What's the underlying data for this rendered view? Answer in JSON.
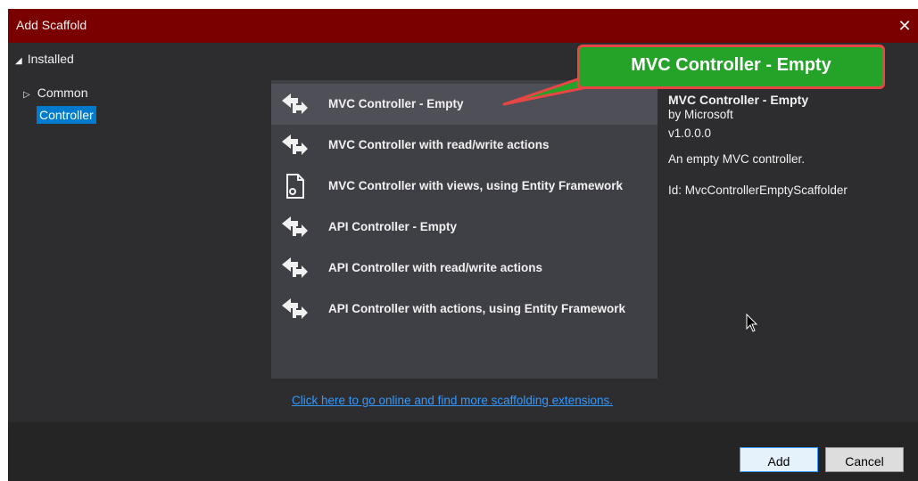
{
  "window": {
    "title": "Add Scaffold",
    "close_glyph": "✕"
  },
  "tree": {
    "installed_label": "Installed",
    "items": [
      {
        "label": "Common",
        "expandable": true,
        "selected": false
      },
      {
        "label": "Controller",
        "expandable": false,
        "selected": true
      }
    ]
  },
  "templates": [
    {
      "label": "MVC Controller - Empty",
      "icon": "controller-icon",
      "selected": true
    },
    {
      "label": "MVC Controller with read/write actions",
      "icon": "controller-icon",
      "selected": false
    },
    {
      "label": "MVC Controller with views, using Entity Framework",
      "icon": "file-gear-icon",
      "selected": false
    },
    {
      "label": "API Controller - Empty",
      "icon": "controller-icon",
      "selected": false
    },
    {
      "label": "API Controller with read/write actions",
      "icon": "controller-icon",
      "selected": false
    },
    {
      "label": "API Controller with actions, using Entity Framework",
      "icon": "controller-icon",
      "selected": false
    }
  ],
  "details": {
    "title": "MVC Controller - Empty",
    "author": "by Microsoft",
    "version": "v1.0.0.0",
    "description": "An empty MVC controller.",
    "id": "Id: MvcControllerEmptyScaffolder"
  },
  "online_link": "Click here to go online and find more scaffolding extensions.",
  "buttons": {
    "add": "Add",
    "cancel": "Cancel"
  },
  "callout": {
    "text": "MVC Controller - Empty",
    "fill": "#25a329",
    "border": "#e84545"
  },
  "colors": {
    "titlebar": "#7a0000",
    "selection": "#007acc",
    "link": "#3399ff"
  }
}
